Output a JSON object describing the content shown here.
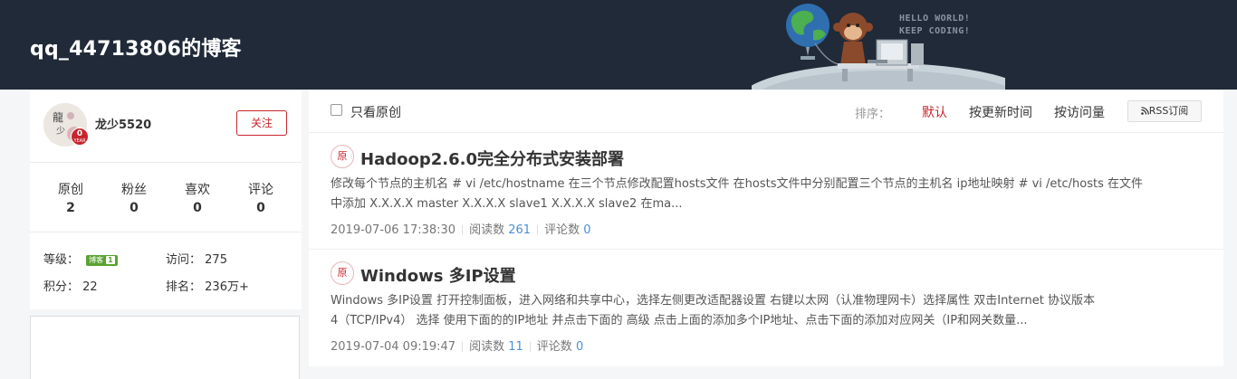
{
  "header": {
    "title": "qq_44713806的博客",
    "banner_text_line1": "HELLO WORLD!",
    "banner_text_line2": "KEEP CODING!"
  },
  "profile": {
    "username": "龙少5520",
    "year_badge_number": "0",
    "year_badge_label": "YEAR",
    "follow_label": "关注",
    "stats": [
      {
        "label": "原创",
        "value": "2"
      },
      {
        "label": "粉丝",
        "value": "0"
      },
      {
        "label": "喜欢",
        "value": "0"
      },
      {
        "label": "评论",
        "value": "0"
      }
    ],
    "level_label": "等级：",
    "level_badge_text": "博客",
    "level_badge_num": "1",
    "visits_label": "访问：",
    "visits_value": "275",
    "points_label": "积分：",
    "points_value": "22",
    "rank_label": "排名：",
    "rank_value": "236万+"
  },
  "toolbar": {
    "only_original_label": "只看原创",
    "sort_label": "排序：",
    "sort_options": [
      "默认",
      "按更新时间",
      "按访问量"
    ],
    "active_sort": "默认",
    "rss_label": "RSS订阅"
  },
  "articles": [
    {
      "tag": "原",
      "title": "Hadoop2.6.0完全分布式安装部署",
      "desc_line1": "修改每个节点的主机名 # vi /etc/hostname 在三个节点修改配置hosts文件 在hosts文件中分别配置三个节点的主机名 ip地址映射 # vi /etc/hosts 在文件",
      "desc_line2": "中添加 X.X.X.X master X.X.X.X slave1 X.X.X.X slave2 在ma...",
      "date": "2019-07-06 17:38:30",
      "reads_label": "阅读数",
      "reads": "261",
      "comments_label": "评论数",
      "comments": "0"
    },
    {
      "tag": "原",
      "title": "Windows 多IP设置",
      "desc_line1": "Windows 多IP设置 打开控制面板，进入网络和共享中心，选择左侧更改适配器设置 右键以太网（认准物理网卡）选择属性 双击Internet 协议版本",
      "desc_line2": "4（TCP/IPv4） 选择 使用下面的的IP地址 并点击下面的 高级 点击上面的添加多个IP地址、点击下面的添加对应网关（IP和网关数量...",
      "date": "2019-07-04 09:19:47",
      "reads_label": "阅读数",
      "reads": "11",
      "comments_label": "评论数",
      "comments": "0"
    }
  ],
  "colors": {
    "header_bg": "#202a38",
    "accent_red": "#c8252d",
    "link_blue": "#4a90d9"
  }
}
